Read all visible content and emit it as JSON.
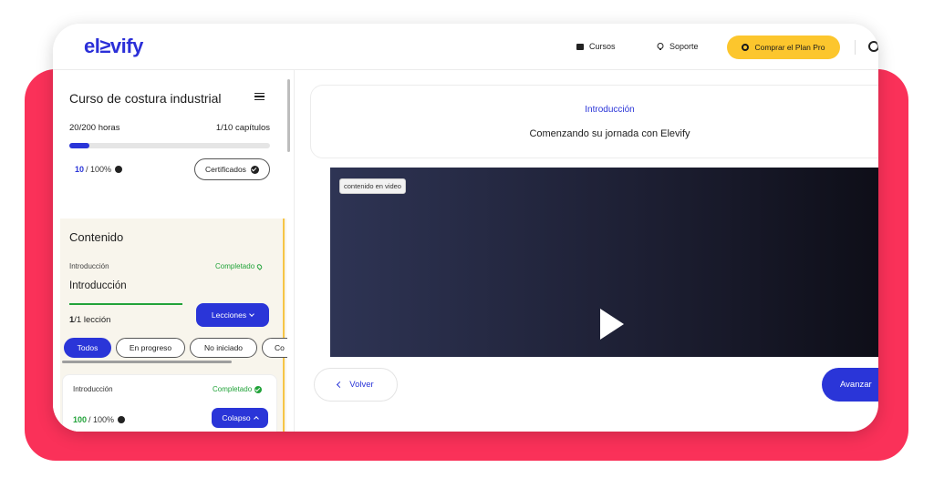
{
  "brand": {
    "logo": "el≥vify",
    "accent_color": "#fa3159",
    "primary_color": "#2a35d8",
    "pro_color": "#fcc62d"
  },
  "topbar": {
    "cursos_label": "Cursos",
    "soporte_label": "Soporte",
    "buy_label": "Comprar el Plan Pro"
  },
  "sidebar": {
    "course_title": "Curso de costura industrial",
    "hours": "20/200 horas",
    "chapters": "1/10 capítulos",
    "progress_fraction": 0.1,
    "percent_value": "10",
    "percent_suffix": "/ 100%",
    "certificates_label": "Certificados",
    "content_heading": "Contenido",
    "section_label": "Introducción",
    "section_status": "Completado",
    "section_title": "Introducción",
    "lesson_count_bold": "1",
    "lesson_count_rest": "/1 lección",
    "lessons_button": "Lecciones",
    "filters": [
      "Todos",
      "En progreso",
      "No iniciado",
      "Co"
    ],
    "card": {
      "label": "Introducción",
      "status": "Completado",
      "percent_value": "100",
      "percent_suffix": "/ 100%",
      "collapse_button": "Colapso"
    }
  },
  "main": {
    "section_subtitle": "Introducción",
    "lesson_title": "Comenzando su jornada con Elevify",
    "video_label": "contenido en video",
    "back_button": "Volver",
    "next_button": "Avanzar"
  }
}
